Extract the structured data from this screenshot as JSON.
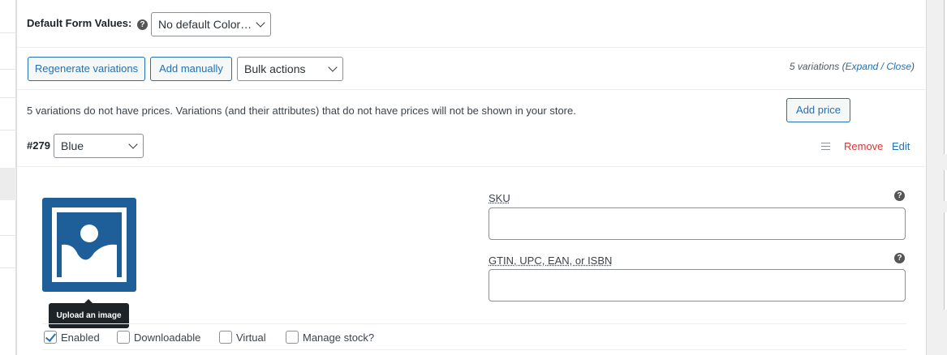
{
  "default_form": {
    "label": "Default Form Values:",
    "help_glyph": "?",
    "select_value": "No default Color…"
  },
  "toolbar": {
    "regenerate_label": "Regenerate variations",
    "add_manually_label": "Add manually",
    "bulk_actions_value": "Bulk actions",
    "count_text": "5 variations",
    "open_paren": "(",
    "expand_label": "Expand",
    "separator": " / ",
    "close_label": "Close",
    "close_paren": ")"
  },
  "notice": {
    "text": "5 variations do not have prices. Variations (and their attributes) that do not have prices will not be shown in your store.",
    "add_price_label": "Add price"
  },
  "variation": {
    "id_label": "#279",
    "attribute_value": "Blue",
    "remove_label": "Remove",
    "edit_label": "Edit",
    "image_tooltip": "Upload an image",
    "sku_label": "SKU",
    "sku_value": "",
    "gtin_label": "GTIN, UPC, EAN, or ISBN",
    "gtin_value": "",
    "help_glyph": "?",
    "options": {
      "enabled": "Enabled",
      "downloadable": "Downloadable",
      "virtual": "Virtual",
      "manage_stock": "Manage stock?"
    },
    "enabled_checked": true
  },
  "colors": {
    "accent": "#2271b1",
    "danger": "#d63638",
    "image_placeholder": "#1e5f99"
  }
}
